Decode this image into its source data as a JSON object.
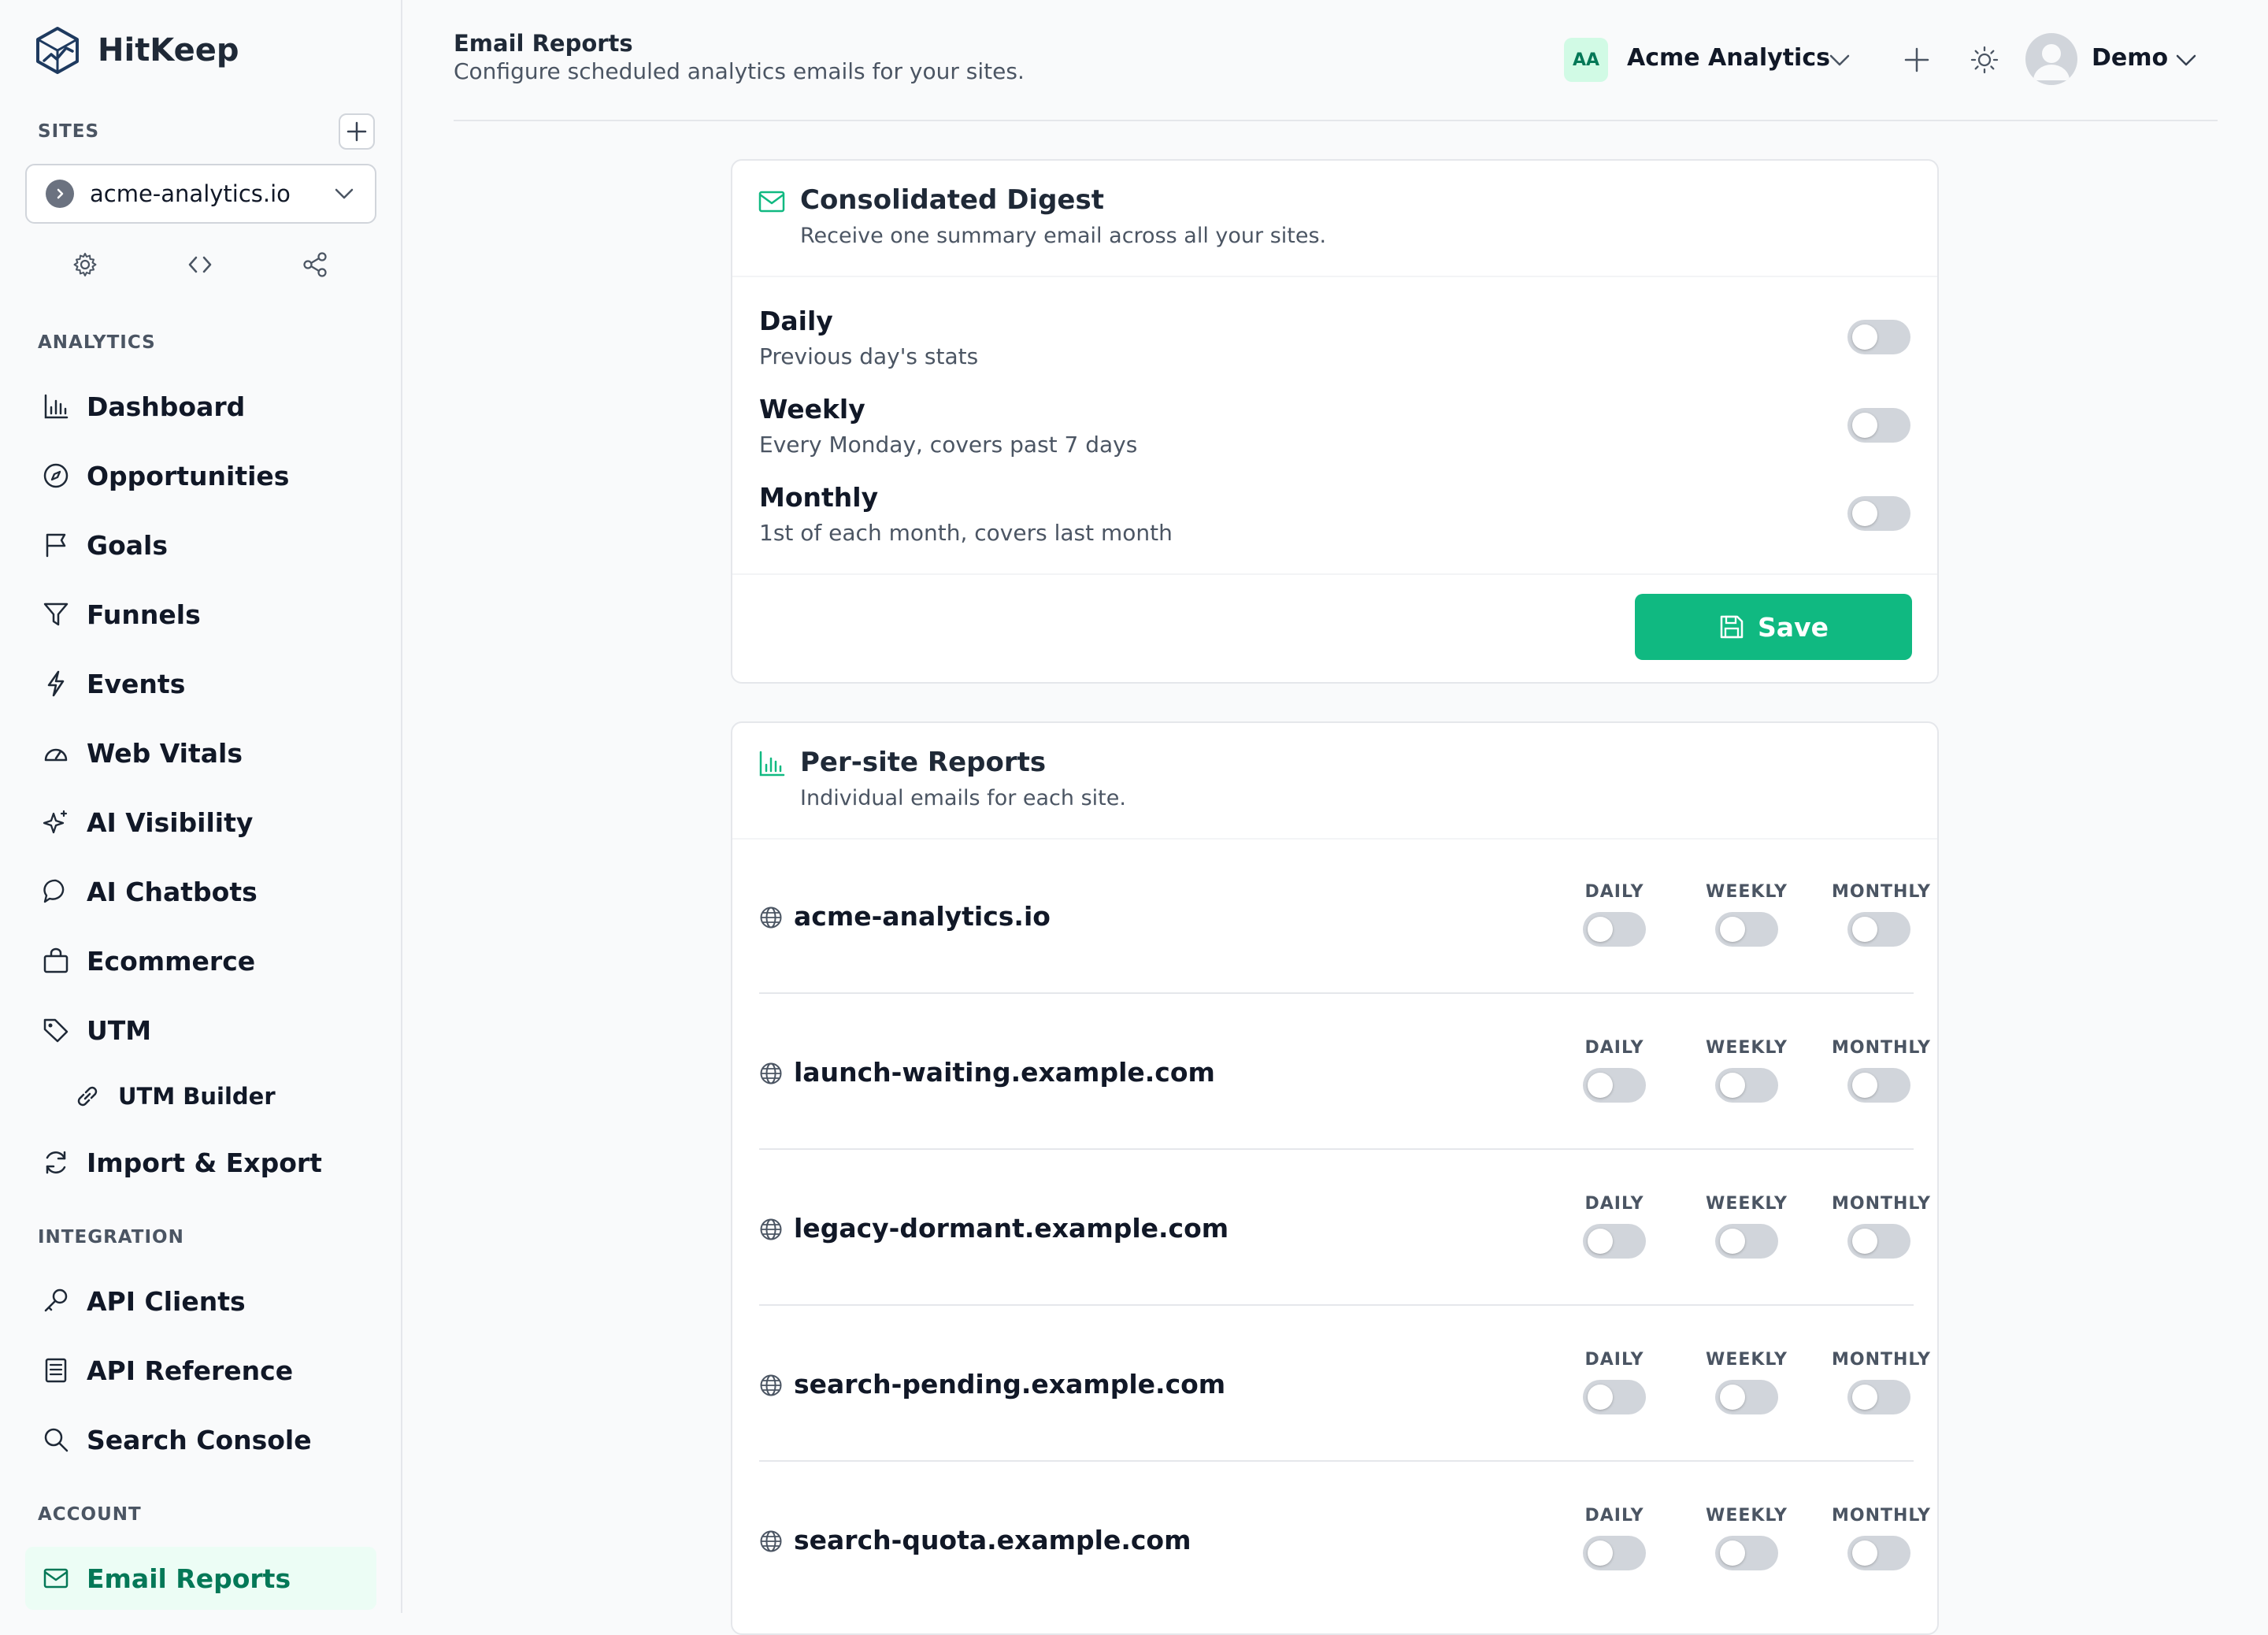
{
  "app": {
    "name": "HitKeep"
  },
  "sidebar": {
    "sites_label": "SITES",
    "selected_site": "acme-analytics.io",
    "analytics_label": "ANALYTICS",
    "analytics_items": [
      {
        "label": "Dashboard",
        "icon": "bar-chart-icon"
      },
      {
        "label": "Opportunities",
        "icon": "compass-icon"
      },
      {
        "label": "Goals",
        "icon": "flag-icon"
      },
      {
        "label": "Funnels",
        "icon": "filter-icon"
      },
      {
        "label": "Events",
        "icon": "lightning-icon"
      },
      {
        "label": "Web Vitals",
        "icon": "gauge-icon"
      },
      {
        "label": "AI Visibility",
        "icon": "sparkle-icon"
      },
      {
        "label": "AI Chatbots",
        "icon": "chat-bubble-icon"
      },
      {
        "label": "Ecommerce",
        "icon": "shopping-bag-icon"
      },
      {
        "label": "UTM",
        "icon": "tag-icon"
      },
      {
        "label": "UTM Builder",
        "icon": "link-icon"
      },
      {
        "label": "Import & Export",
        "icon": "refresh-icon"
      }
    ],
    "integration_label": "INTEGRATION",
    "integration_items": [
      {
        "label": "API Clients",
        "icon": "key-icon"
      },
      {
        "label": "API Reference",
        "icon": "document-icon"
      },
      {
        "label": "Search Console",
        "icon": "search-icon"
      }
    ],
    "account_label": "ACCOUNT",
    "account_items": [
      {
        "label": "Email Reports",
        "icon": "envelope-icon",
        "active": true
      }
    ]
  },
  "header": {
    "title": "Email Reports",
    "subtitle": "Configure scheduled analytics emails for your sites.",
    "org_initials": "AA",
    "org_name": "Acme Analytics",
    "user_name": "Demo"
  },
  "digest": {
    "title": "Consolidated Digest",
    "description": "Receive one summary email across all your sites.",
    "options": [
      {
        "title": "Daily",
        "description": "Previous day's stats",
        "enabled": false
      },
      {
        "title": "Weekly",
        "description": "Every Monday, covers past 7 days",
        "enabled": false
      },
      {
        "title": "Monthly",
        "description": "1st of each month, covers last month",
        "enabled": false
      }
    ],
    "save_label": "Save"
  },
  "per_site": {
    "title": "Per-site Reports",
    "description": "Individual emails for each site.",
    "columns": [
      "DAILY",
      "WEEKLY",
      "MONTHLY"
    ],
    "sites": [
      {
        "name": "acme-analytics.io",
        "daily": false,
        "weekly": false,
        "monthly": false
      },
      {
        "name": "launch-waiting.example.com",
        "daily": false,
        "weekly": false,
        "monthly": false
      },
      {
        "name": "legacy-dormant.example.com",
        "daily": false,
        "weekly": false,
        "monthly": false
      },
      {
        "name": "search-pending.example.com",
        "daily": false,
        "weekly": false,
        "monthly": false
      },
      {
        "name": "search-quota.example.com",
        "daily": false,
        "weekly": false,
        "monthly": false
      }
    ]
  },
  "colors": {
    "accent": "#10b981",
    "accent_dark": "#047857",
    "toggle_off": "#d1d5db"
  }
}
